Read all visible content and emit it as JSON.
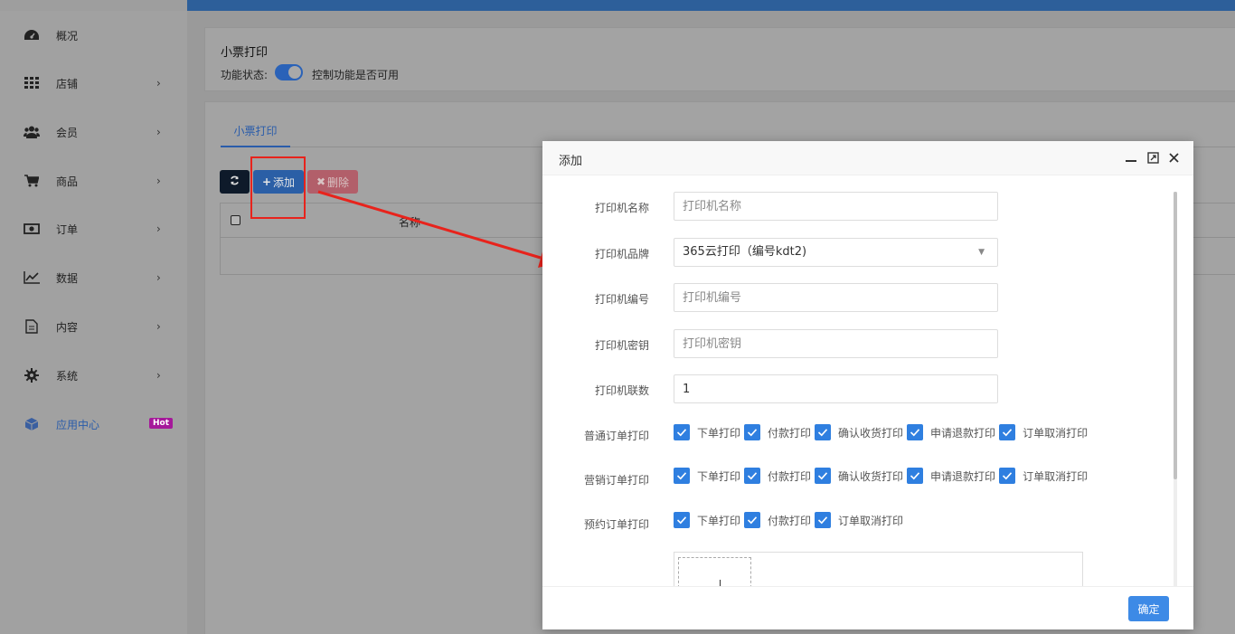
{
  "sidebar": {
    "items": [
      {
        "label": "概况",
        "icon": "dashboard-icon"
      },
      {
        "label": "店铺",
        "icon": "grid-icon",
        "chevron": "›"
      },
      {
        "label": "会员",
        "icon": "users-icon",
        "chevron": "›"
      },
      {
        "label": "商品",
        "icon": "cart-icon",
        "chevron": "›"
      },
      {
        "label": "订单",
        "icon": "money-icon",
        "chevron": "›"
      },
      {
        "label": "数据",
        "icon": "line-chart-icon",
        "chevron": "›"
      },
      {
        "label": "内容",
        "icon": "document-icon",
        "chevron": "›"
      },
      {
        "label": "系统",
        "icon": "gear-icon",
        "chevron": "›"
      },
      {
        "label": "应用中心",
        "icon": "cube-icon",
        "badge": "Hot"
      }
    ]
  },
  "header_panel": {
    "title": "小票打印",
    "status_label": "功能状态:",
    "status_desc": "控制功能是否可用",
    "toggle_on": true
  },
  "main_panel": {
    "tab": "小票打印",
    "add_label": "添加",
    "delete_label": "删除",
    "table_column_name": "名称"
  },
  "modal": {
    "title": "添加",
    "fields": {
      "name": {
        "label": "打印机名称",
        "placeholder": "打印机名称"
      },
      "brand": {
        "label": "打印机品牌",
        "value": "365云打印（编号kdt2)"
      },
      "number": {
        "label": "打印机编号",
        "placeholder": "打印机编号"
      },
      "secret": {
        "label": "打印机密钥",
        "placeholder": "打印机密钥"
      },
      "copies": {
        "label": "打印机联数",
        "value": "1"
      }
    },
    "normal_orders": {
      "label": "普通订单打印",
      "options": [
        "下单打印",
        "付款打印",
        "确认收货打印",
        "申请退款打印",
        "订单取消打印"
      ]
    },
    "marketing_orders": {
      "label": "营销订单打印",
      "options": [
        "下单打印",
        "付款打印",
        "确认收货打印",
        "申请退款打印",
        "订单取消打印"
      ]
    },
    "reservation_orders": {
      "label": "预约订单打印",
      "options": [
        "下单打印",
        "付款打印",
        "订单取消打印"
      ]
    },
    "ok_label": "确定"
  },
  "colors": {
    "accent": "#2f7fe0",
    "annotation": "#e8231c"
  }
}
